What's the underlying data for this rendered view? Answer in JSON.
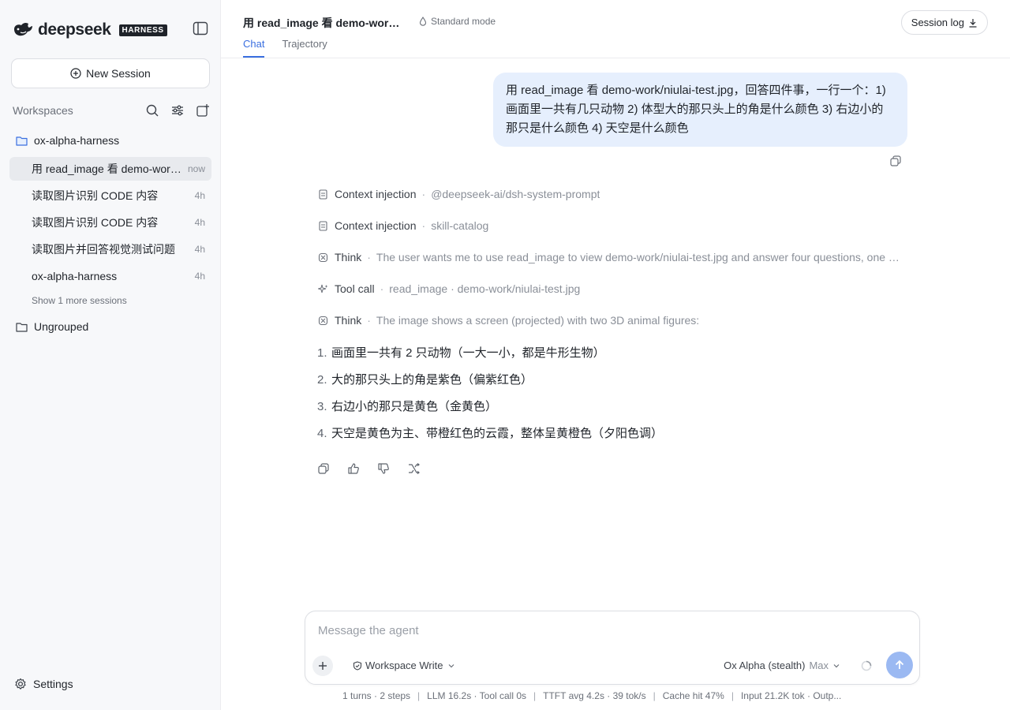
{
  "brand": {
    "name": "deepseek",
    "tag": "HARNESS"
  },
  "sidebar": {
    "new_session_label": "New Session",
    "workspaces_label": "Workspaces",
    "workspace": {
      "name": "ox-alpha-harness"
    },
    "sessions": [
      {
        "title": "用 read_image 看 demo-work/niulai-test.jpg，回答四件事",
        "time": "now"
      },
      {
        "title": "读取图片识别 CODE 内容",
        "time": "4h"
      },
      {
        "title": "读取图片识别 CODE 内容",
        "time": "4h"
      },
      {
        "title": "读取图片并回答视觉测试问题",
        "time": "4h"
      },
      {
        "title": "ox-alpha-harness",
        "time": "4h"
      }
    ],
    "show_more_label": "Show 1 more sessions",
    "ungrouped_label": "Ungrouped",
    "settings_label": "Settings"
  },
  "header": {
    "session_title": "用 read_image 看 demo-work/niulai-test.jpg",
    "mode_label": "Standard mode",
    "tabs": [
      {
        "label": "Chat"
      },
      {
        "label": "Trajectory"
      }
    ],
    "session_log_label": "Session log"
  },
  "chat": {
    "user_message": "用 read_image 看 demo-work/niulai-test.jpg，回答四件事，一行一个：1) 画面里一共有几只动物 2) 体型大的那只头上的角是什么颜色 3) 右边小的那只是什么颜色 4) 天空是什么颜色",
    "steps": [
      {
        "kind": "Context injection",
        "detail": "@deepseek-ai/dsh-system-prompt",
        "icon": "document-icon"
      },
      {
        "kind": "Context injection",
        "detail": "skill-catalog",
        "icon": "document-icon"
      },
      {
        "kind": "Think",
        "detail": "The user wants me to use read_image to view demo-work/niulai-test.jpg and answer four questions, one per line.",
        "icon": "brain-icon"
      },
      {
        "kind": "Tool call",
        "detail": "read_image · demo-work/niulai-test.jpg",
        "icon": "sparkle-icon"
      },
      {
        "kind": "Think",
        "detail": "The image shows a screen (projected) with two 3D animal figures:",
        "icon": "brain-icon"
      }
    ],
    "answer": [
      {
        "num": "1.",
        "text": "画面里一共有 2 只动物（一大一小，都是牛形生物）"
      },
      {
        "num": "2.",
        "text": "大的那只头上的角是紫色（偏紫红色）"
      },
      {
        "num": "3.",
        "text": "右边小的那只是黄色（金黄色）"
      },
      {
        "num": "4.",
        "text": "天空是黄色为主、带橙红色的云霞，整体呈黄橙色（夕阳色调）"
      }
    ]
  },
  "composer": {
    "placeholder": "Message the agent",
    "permission_label": "Workspace Write",
    "model_label": "Ox Alpha (stealth)",
    "level_label": "Max"
  },
  "stats": {
    "turns": "1 turns · 2 steps",
    "latency": "LLM 16.2s · Tool call 0s",
    "ttft": "TTFT avg 4.2s · 39 tok/s",
    "cache": "Cache hit 47%",
    "tokens": "Input 21.2K tok · Outp..."
  },
  "colors": {
    "accent": "#3a6fe0",
    "user_bubble": "#e6effd",
    "send_button": "#9bb9f2"
  }
}
